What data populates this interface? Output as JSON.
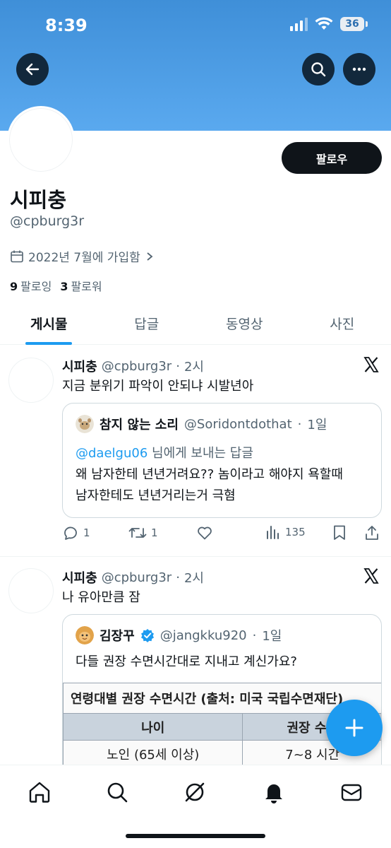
{
  "status_bar": {
    "time": "8:39",
    "battery": "36"
  },
  "profile": {
    "display_name": "시피충",
    "handle": "@cpburg3r",
    "joined": "2022년 7월에 가입함",
    "following_count": "9",
    "following_label": "팔로잉",
    "followers_count": "3",
    "followers_label": "팔로워",
    "follow_button": "팔로우"
  },
  "tabs": [
    {
      "label": "게시물",
      "active": true
    },
    {
      "label": "답글",
      "active": false
    },
    {
      "label": "동영상",
      "active": false
    },
    {
      "label": "사진",
      "active": false
    }
  ],
  "posts": [
    {
      "author": "시피충",
      "handle": "@cpburg3r",
      "time": "2시",
      "text": "지금 분위기 파악이 안되냐 시발년아",
      "quote": {
        "author": "참지 않는 소리",
        "handle": "@Soridontdothat",
        "time": "1일",
        "reply_mention": "@daelgu06",
        "reply_suffix": " 님에게 보내는 답글",
        "line1": "왜 남자한테 년년거려요?? 놈이라고 해야지 욕할때",
        "line2": "남자한테도 년년거리는거 극혐"
      },
      "replies": "1",
      "reposts": "1",
      "views": "135"
    },
    {
      "author": "시피충",
      "handle": "@cpburg3r",
      "time": "2시",
      "text": "나 유아만큼 잠",
      "quote": {
        "author": "김장꾸",
        "handle": "@jangkku920",
        "time": "1일",
        "text": "다들 권장 수면시간대로 지내고 계신가요?",
        "table_title": "연령대별 권장 수면시간 (출처: 미국 국립수면재단)",
        "col1": "나이",
        "col2": "권장 수면",
        "row1_col1": "노인 (65세 이상)",
        "row1_col2": "7~8 시간"
      }
    }
  ],
  "colors": {
    "accent": "#1d9bf0",
    "banner": "#4a9be3",
    "text": "#0f1419",
    "muted": "#536471"
  }
}
